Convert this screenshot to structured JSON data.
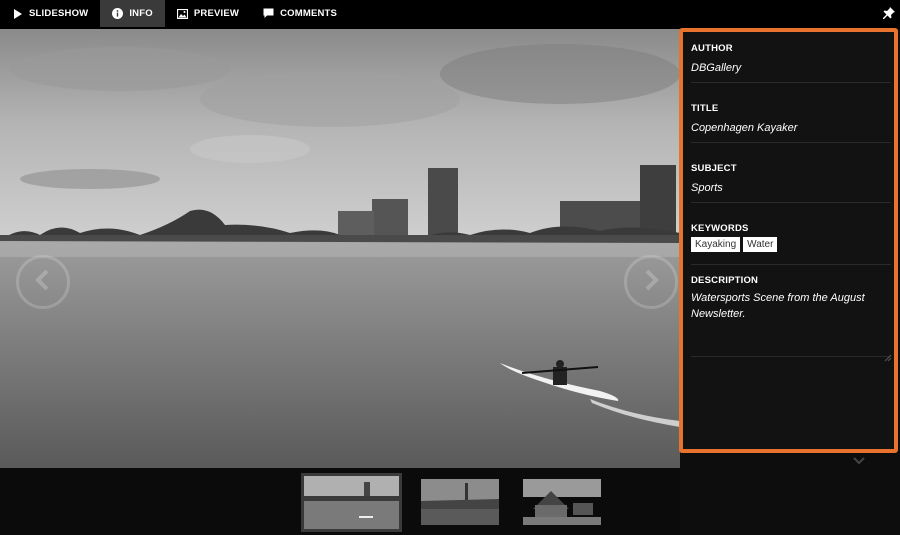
{
  "toolbar": {
    "tabs": [
      {
        "label": "SLIDESHOW",
        "icon": "play-icon",
        "active": false
      },
      {
        "label": "INFO",
        "icon": "info-icon",
        "active": true
      },
      {
        "label": "PREVIEW",
        "icon": "image-icon",
        "active": false
      },
      {
        "label": "COMMENTS",
        "icon": "comment-icon",
        "active": false
      }
    ],
    "pin_icon": "pin-icon"
  },
  "info": {
    "author_label": "AUTHOR",
    "author": "DBGallery",
    "title_label": "TITLE",
    "title": "Copenhagen Kayaker",
    "subject_label": "SUBJECT",
    "subject": "Sports",
    "keywords_label": "KEYWORDS",
    "keywords": [
      "Kayaking",
      "Water"
    ],
    "description_label": "DESCRIPTION",
    "description": "Watersports Scene from the August Newsletter."
  },
  "colors": {
    "highlight": "#e8732d",
    "active_tab": "#3a3a3a",
    "background": "#000000"
  }
}
